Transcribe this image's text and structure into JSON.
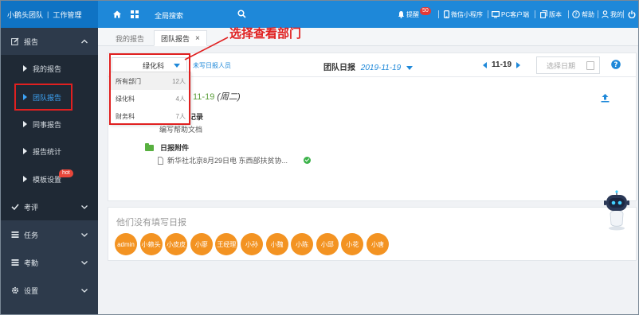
{
  "header": {
    "brand": "小鹅头团队",
    "brand_section": "工作管理",
    "search_label": "全局搜索",
    "right_items": [
      {
        "icon": "bell-icon",
        "label": "提醒",
        "badge": "50"
      },
      {
        "icon": "phone-icon",
        "label": "微信小程序"
      },
      {
        "icon": "monitor-icon",
        "label": "PC客户端"
      },
      {
        "icon": "copy-icon",
        "label": "版本"
      },
      {
        "icon": "help-icon",
        "label": "帮助"
      },
      {
        "icon": "user-icon",
        "label": "我的"
      }
    ]
  },
  "sidebar": {
    "report": {
      "label": "报告"
    },
    "sub_items": [
      {
        "label": "我的报告"
      },
      {
        "label": "团队报告"
      },
      {
        "label": "同事报告"
      },
      {
        "label": "报告统计"
      },
      {
        "label": "模板设置",
        "badge": "hot"
      }
    ],
    "sections": [
      {
        "label": "考评"
      },
      {
        "label": "任务"
      },
      {
        "label": "考勤"
      },
      {
        "label": "设置"
      }
    ]
  },
  "tabs": [
    {
      "label": "我的报告"
    },
    {
      "label": "团队报告",
      "close": "×"
    }
  ],
  "toolbar": {
    "department_value": "绿化科",
    "unfilled_link": "未写日报人员",
    "title": "团队日报",
    "title_date": "2019-11-19",
    "nav_date": "11-19",
    "date_placeholder": "选择日期"
  },
  "dropdown": {
    "options": [
      {
        "label": "所有部门",
        "count": "12人"
      },
      {
        "label": "绿化科",
        "count": "4人"
      },
      {
        "label": "财务科",
        "count": "7人"
      }
    ]
  },
  "annotation": "选择查看部门",
  "report": {
    "date": "11-19",
    "weekday": "(周二)",
    "work_title": "今日工作记录",
    "work_text": "编写帮助文档",
    "attach_title": "日报附件",
    "attach_file": "新华社北京8月29日电 东西部扶贫协..."
  },
  "missing": {
    "title": "他们没有填写日报",
    "people": [
      "admin",
      "小赖头",
      "小皮皮",
      "小廖",
      "王经理",
      "小孙",
      "小魏",
      "小陈",
      "小邱",
      "小花",
      "小唐"
    ]
  },
  "colors": {
    "primary": "#1e88d9",
    "sidebar": "#2d3a4b",
    "avatar": "#f39322",
    "highlight": "#e02020"
  }
}
